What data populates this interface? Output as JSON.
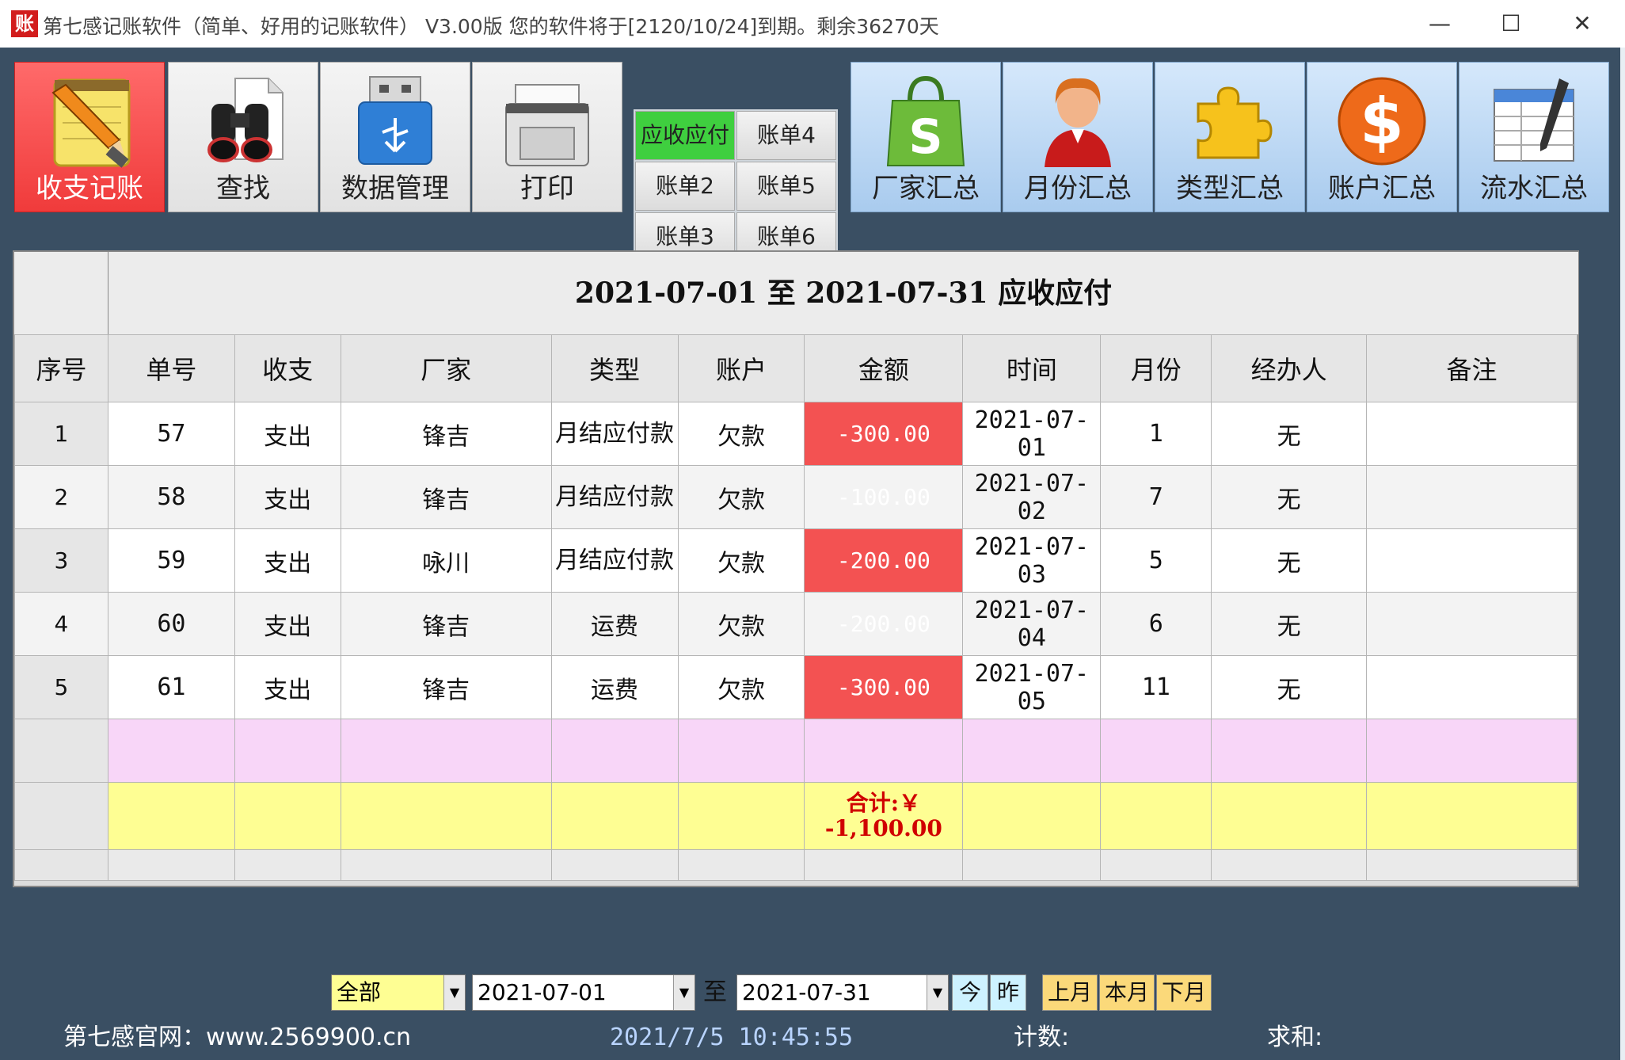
{
  "window": {
    "app_icon_text": "账",
    "title": "第七感记账软件（简单、好用的记账软件） V3.00版 您的软件将于[2120/10/24]到期。剩余36270天",
    "minimize": "—",
    "maximize": "☐",
    "close": "✕"
  },
  "toolbar": {
    "income_expense": "收支记账",
    "search": "查找",
    "data_mgmt": "数据管理",
    "print": "打印",
    "ledgers": [
      "应收应付",
      "账单4",
      "账单2",
      "账单5",
      "账单3",
      "账单6"
    ],
    "vendor_summary": "厂家汇总",
    "month_summary": "月份汇总",
    "type_summary": "类型汇总",
    "account_summary": "账户汇总",
    "flow_summary": "流水汇总"
  },
  "report": {
    "banner": "2021-07-01  至  2021-07-31  应收应付",
    "columns": [
      "序号",
      "单号",
      "收支",
      "厂家",
      "类型",
      "账户",
      "金额",
      "时间",
      "月份",
      "经办人",
      "备注"
    ],
    "rows": [
      {
        "idx": "1",
        "no": "57",
        "io": "支出",
        "vendor": "锋吉",
        "type": "月结应付款",
        "account": "欠款",
        "amount": "-300.00",
        "date": "2021-07-01",
        "month": "1",
        "handler": "无",
        "note": ""
      },
      {
        "idx": "2",
        "no": "58",
        "io": "支出",
        "vendor": "锋吉",
        "type": "月结应付款",
        "account": "欠款",
        "amount": "-100.00",
        "date": "2021-07-02",
        "month": "7",
        "handler": "无",
        "note": ""
      },
      {
        "idx": "3",
        "no": "59",
        "io": "支出",
        "vendor": "咏川",
        "type": "月结应付款",
        "account": "欠款",
        "amount": "-200.00",
        "date": "2021-07-03",
        "month": "5",
        "handler": "无",
        "note": ""
      },
      {
        "idx": "4",
        "no": "60",
        "io": "支出",
        "vendor": "锋吉",
        "type": "运费",
        "account": "欠款",
        "amount": "-200.00",
        "date": "2021-07-04",
        "month": "6",
        "handler": "无",
        "note": ""
      },
      {
        "idx": "5",
        "no": "61",
        "io": "支出",
        "vendor": "锋吉",
        "type": "运费",
        "account": "欠款",
        "amount": "-300.00",
        "date": "2021-07-05",
        "month": "11",
        "handler": "无",
        "note": ""
      }
    ],
    "total_label": "合计:￥",
    "total_value": "-1,100.00"
  },
  "filter": {
    "category": "全部",
    "from_date": "2021-07-01",
    "to_label": "至",
    "to_date": "2021-07-31",
    "today": "今",
    "yesterday": "昨",
    "prev_month": "上月",
    "this_month": "本月",
    "next_month": "下月"
  },
  "status": {
    "website": "第七感官网：www.2569900.cn",
    "datetime": "2021/7/5 10:45:55",
    "count_label": "计数:",
    "sum_label": "求和:"
  },
  "colors": {
    "accent_red": "#f35252",
    "selected_ledger": "#3fcf3f",
    "total_row": "#fefe93",
    "new_row": "#f8d6f8"
  }
}
